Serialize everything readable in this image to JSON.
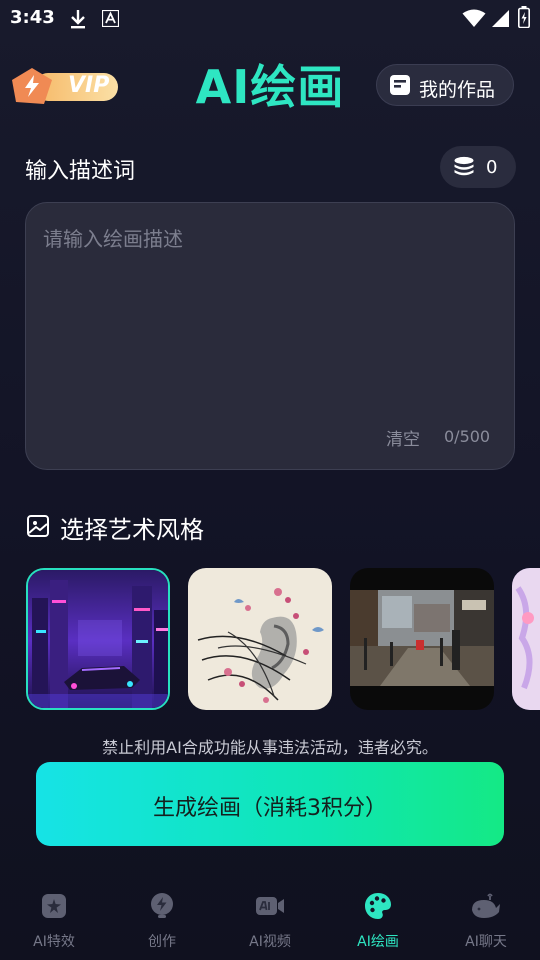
{
  "status_bar": {
    "time": "3:43"
  },
  "header": {
    "vip_label": "VIP",
    "title": "AI绘画",
    "my_works_label": "我的作品"
  },
  "prompt": {
    "section_label": "输入描述词",
    "credits": "0",
    "placeholder": "请输入绘画描述",
    "value": "",
    "clear_label": "清空",
    "counter": "0/500"
  },
  "style_section": {
    "label": "选择艺术风格",
    "cards": [
      {
        "style": "cyberpunk",
        "selected": true
      },
      {
        "style": "ink-painting",
        "selected": false
      },
      {
        "style": "street-photo",
        "selected": false
      },
      {
        "style": "anime",
        "selected": false
      }
    ]
  },
  "disclaimer": "禁止利用AI合成功能从事违法活动，违者必究。",
  "generate_button": "生成绘画（消耗3积分）",
  "tabs": [
    {
      "label": "AI特效",
      "icon": "sparkle-icon",
      "active": false
    },
    {
      "label": "创作",
      "icon": "lightning-icon",
      "active": false
    },
    {
      "label": "AI视频",
      "icon": "video-camera-icon",
      "active": false
    },
    {
      "label": "AI绘画",
      "icon": "palette-icon",
      "active": true
    },
    {
      "label": "AI聊天",
      "icon": "whale-icon",
      "active": false
    }
  ],
  "colors": {
    "accent": "#2ee6c2",
    "background": "#141526",
    "button_gradient_start": "#16e3e6",
    "button_gradient_end": "#14e985"
  }
}
